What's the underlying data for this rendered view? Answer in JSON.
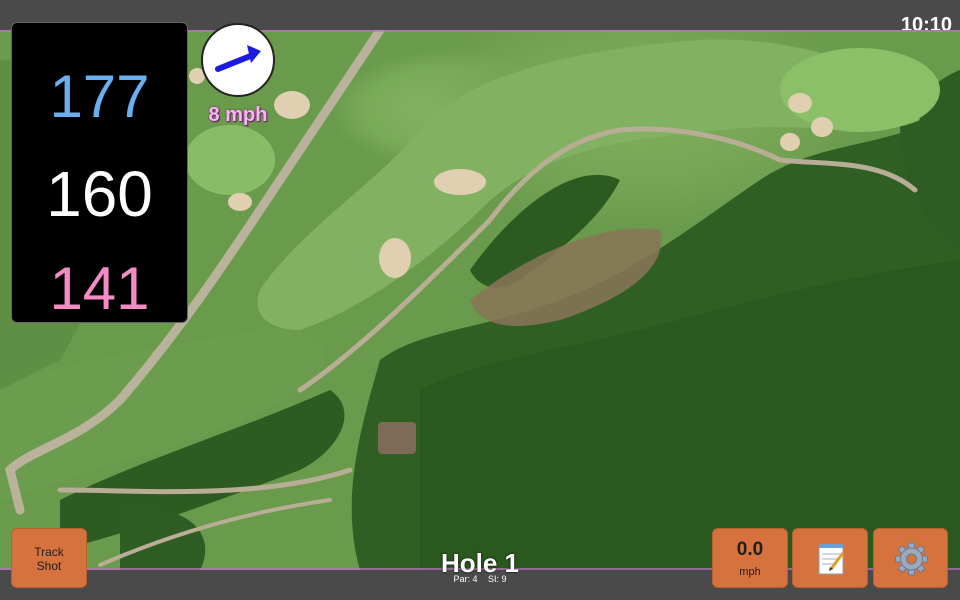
{
  "status_bar": {
    "time": "10:10"
  },
  "distances": {
    "back": "177",
    "middle": "160",
    "front": "141"
  },
  "wind": {
    "speed": "8 mph",
    "arrow_icon": "wind-arrow-icon"
  },
  "hole": {
    "title": "Hole 1",
    "par_label": "Par: 4",
    "si_label": "SI: 9"
  },
  "buttons": {
    "track_shot_line1": "Track",
    "track_shot_line2": "Shot",
    "speed_value": "0.0",
    "speed_unit": "mph",
    "notes_icon": "notepad-icon",
    "settings_icon": "gear-icon"
  },
  "colors": {
    "back_distance": "#6ab0f0",
    "middle_distance": "#ffffff",
    "front_distance": "#f38bc4",
    "button": "#d6723e",
    "wind_speed": "#f4b8ef"
  }
}
